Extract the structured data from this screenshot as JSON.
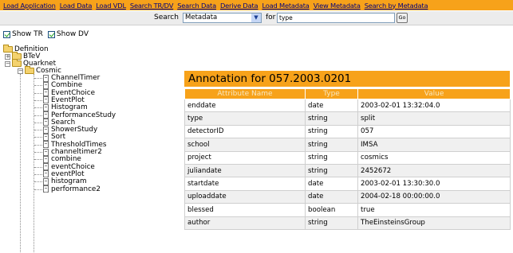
{
  "nav": [
    "Load Application",
    "Load Data",
    "Load VDL",
    "Search TR/DV",
    "Search Data",
    "Derive Data",
    "Load Metadata",
    "View Metadata",
    "Search by Metadata"
  ],
  "search": {
    "label": "Search",
    "selected": "Metadata",
    "for_label": "for",
    "value": "type",
    "go_label": "Go"
  },
  "show": {
    "tr_label": "Show TR",
    "dv_label": "Show DV"
  },
  "tree": {
    "root": "Definition",
    "btev": "BTeV",
    "quarknet": "Quarknet",
    "cosmic": "Cosmic",
    "items": [
      "ChannelTimer",
      "Combine",
      "EventChoice",
      "EventPlot",
      "Histogram",
      "PerformanceStudy",
      "Search",
      "ShowerStudy",
      "Sort",
      "ThresholdTimes",
      "channeltimer2",
      "combine",
      "eventChoice",
      "eventPlot",
      "histogram",
      "performance2"
    ]
  },
  "annotation": {
    "title": "Annotation for 057.2003.0201",
    "headers": [
      "Attribute Name",
      "Type",
      "Value"
    ],
    "rows": [
      [
        "enddate",
        "date",
        "2003-02-01 13:32:04.0"
      ],
      [
        "type",
        "string",
        "split"
      ],
      [
        "detectorID",
        "string",
        "057"
      ],
      [
        "school",
        "string",
        "IMSA"
      ],
      [
        "project",
        "string",
        "cosmics"
      ],
      [
        "juliandate",
        "string",
        "2452672"
      ],
      [
        "startdate",
        "date",
        "2003-02-01 13:30:30.0"
      ],
      [
        "uploaddate",
        "date",
        "2004-02-18 00:00:00.0"
      ],
      [
        "blessed",
        "boolean",
        "true"
      ],
      [
        "author",
        "string",
        "TheEinsteinsGroup"
      ]
    ]
  },
  "colors": {
    "accent": "#f7a21a",
    "link": "#000080"
  }
}
